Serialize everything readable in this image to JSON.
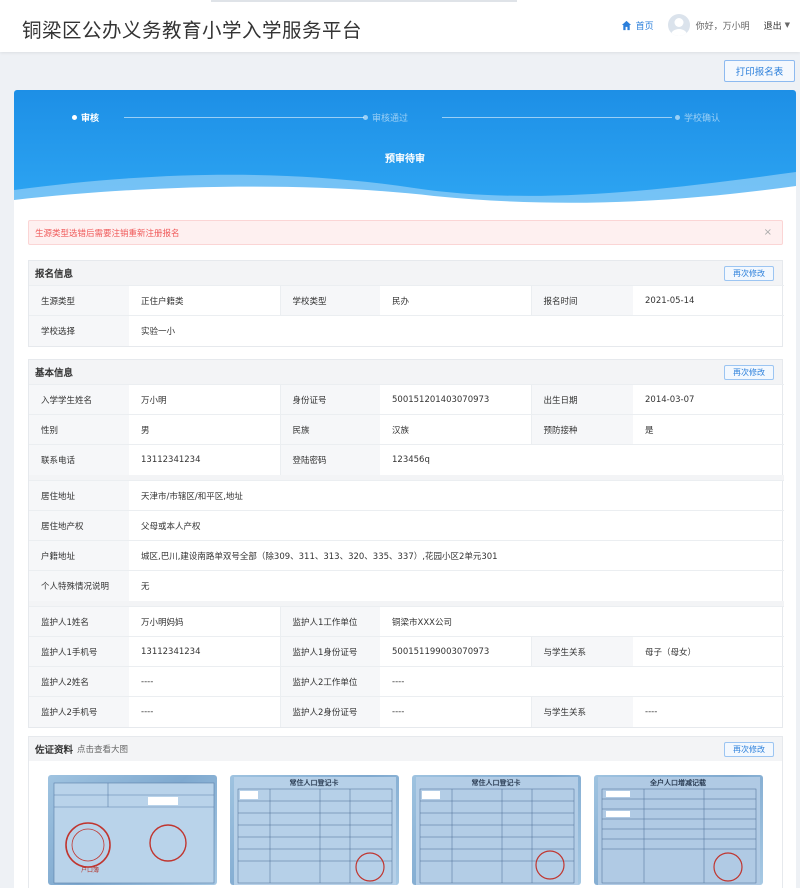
{
  "header": {
    "title": "铜梁区公办义务教育小学入学服务平台",
    "home_label": "首页",
    "greeting": "你好，万小明",
    "logout_label": "退出"
  },
  "print_button": "打印报名表",
  "progress": {
    "steps": [
      {
        "label": "审核",
        "state": "active"
      },
      {
        "label": "审核通过",
        "state": "pending"
      },
      {
        "label": "学校确认",
        "state": "pending"
      }
    ],
    "status": "预审待审"
  },
  "alert": {
    "message": "生源类型选错后需要注销重新注册报名",
    "close": "×"
  },
  "registration": {
    "title": "报名信息",
    "edit_label": "再次修改",
    "rows": [
      [
        "生源类型",
        "正住户籍类",
        "学校类型",
        "民办",
        "报名时间",
        "2021-05-14"
      ],
      [
        "学校选择",
        "实验一小"
      ]
    ]
  },
  "basic": {
    "title": "基本信息",
    "edit_label": "再次修改",
    "student_rows": [
      [
        "入学学生姓名",
        "万小明",
        "身份证号",
        "500151201403070973",
        "出生日期",
        "2014-03-07"
      ],
      [
        "性别",
        "男",
        "民族",
        "汉族",
        "预防接种",
        "是"
      ],
      [
        "联系电话",
        "13112341234",
        "登陆密码",
        "123456q"
      ]
    ],
    "address_rows": [
      [
        "居住地址",
        "天津市/市辖区/和平区,地址"
      ],
      [
        "居住地产权",
        "父母或本人产权"
      ],
      [
        "户籍地址",
        "城区,巴川,建设南路单双号全部（除309、311、313、320、335、337）,花园小区2单元301"
      ],
      [
        "个人特殊情况说明",
        "无"
      ]
    ],
    "guardian_rows": [
      [
        "监护人1姓名",
        "万小明妈妈",
        "监护人1工作单位",
        "铜梁市XXX公司"
      ],
      [
        "监护人1手机号",
        "13112341234",
        "监护人1身份证号",
        "500151199003070973",
        "与学生关系",
        "母子（母女）"
      ],
      [
        "监护人2姓名",
        "----",
        "监护人2工作单位",
        "----"
      ],
      [
        "监护人2手机号",
        "----",
        "监护人2身份证号",
        "----",
        "与学生关系",
        "----"
      ]
    ]
  },
  "evidence": {
    "title": "佐证资料",
    "hint": "点击查看大图",
    "edit_label": "再次修改",
    "docs": [
      {
        "name": "户口簿首页",
        "header": "",
        "doc_title": "户口簿"
      },
      {
        "name": "常住人口登记卡",
        "header": "常住人口登记卡",
        "doc_title": ""
      },
      {
        "name": "常住人口登记卡",
        "header": "常住人口登记卡",
        "doc_title": ""
      },
      {
        "name": "全户人口增减记载",
        "header": "全户人口增减记载",
        "doc_title": ""
      }
    ]
  },
  "colors": {
    "brand": "#2b7fdb",
    "hero_start": "#1d8fe6",
    "hero_end": "#2ea6f3",
    "alert_text": "#f05a5a"
  }
}
